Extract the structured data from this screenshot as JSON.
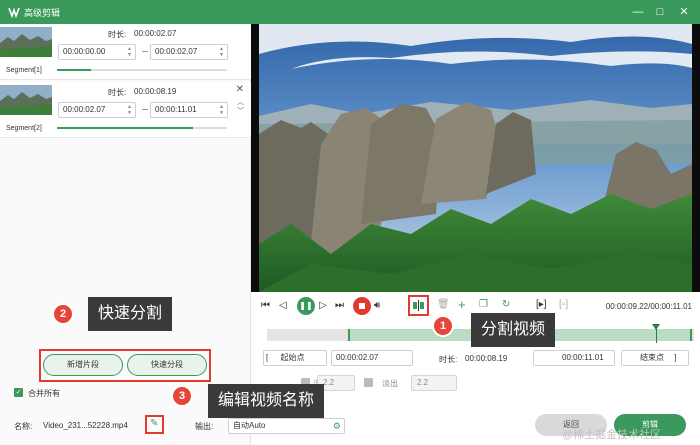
{
  "window": {
    "title": "高级剪辑"
  },
  "segments": [
    {
      "label": "Segment[1]",
      "duration_label": "时长:",
      "duration": "00:00:02.07",
      "start": "00:00:00.00",
      "end": "00:00:02.07",
      "progress": 0.2
    },
    {
      "label": "Segment[2]",
      "duration_label": "时长:",
      "duration": "00:00:08.19",
      "start": "00:00:02.07",
      "end": "00:00:11.01",
      "progress": 0.8
    }
  ],
  "left_buttons": {
    "add_segment": "新增片段",
    "quick_split": "快速分段"
  },
  "merge_all": {
    "label": "合并所有",
    "checked": true
  },
  "playback": {
    "current": "00:00:09.22",
    "total": "00:00:11.01",
    "readout": "00:00:09.22/00:00:11.01"
  },
  "timeline": {
    "selection_start_fraction": 0.19,
    "playhead_fraction": 0.91
  },
  "range_row": {
    "start_button": "起始点",
    "start_value": "00:00:02.07",
    "duration_label": "时长:",
    "duration_value": "00:00:08.19",
    "end_value": "00:00:11.01",
    "end_button": "结束点"
  },
  "fade": {
    "fade_in_label": "淡入",
    "fade_in_value": "2.2",
    "fade_out_label": "淡出",
    "fade_out_value": "2.2"
  },
  "footer": {
    "name_label": "名称:",
    "file_name": "Video_231...52228.mp4",
    "output_label": "输出:",
    "output_value": "自动Auto",
    "back_button": "返回",
    "export_button": "剪辑"
  },
  "callouts": [
    {
      "number": "1",
      "text": "分割视频"
    },
    {
      "number": "2",
      "text": "快速分割"
    },
    {
      "number": "3",
      "text": "编辑视频名称"
    }
  ],
  "watermark": "@稀土掘金技术社区",
  "colors": {
    "accent": "#3a9a5b",
    "highlight": "#e23a2e",
    "callout_bg": "#3a3a3a"
  }
}
